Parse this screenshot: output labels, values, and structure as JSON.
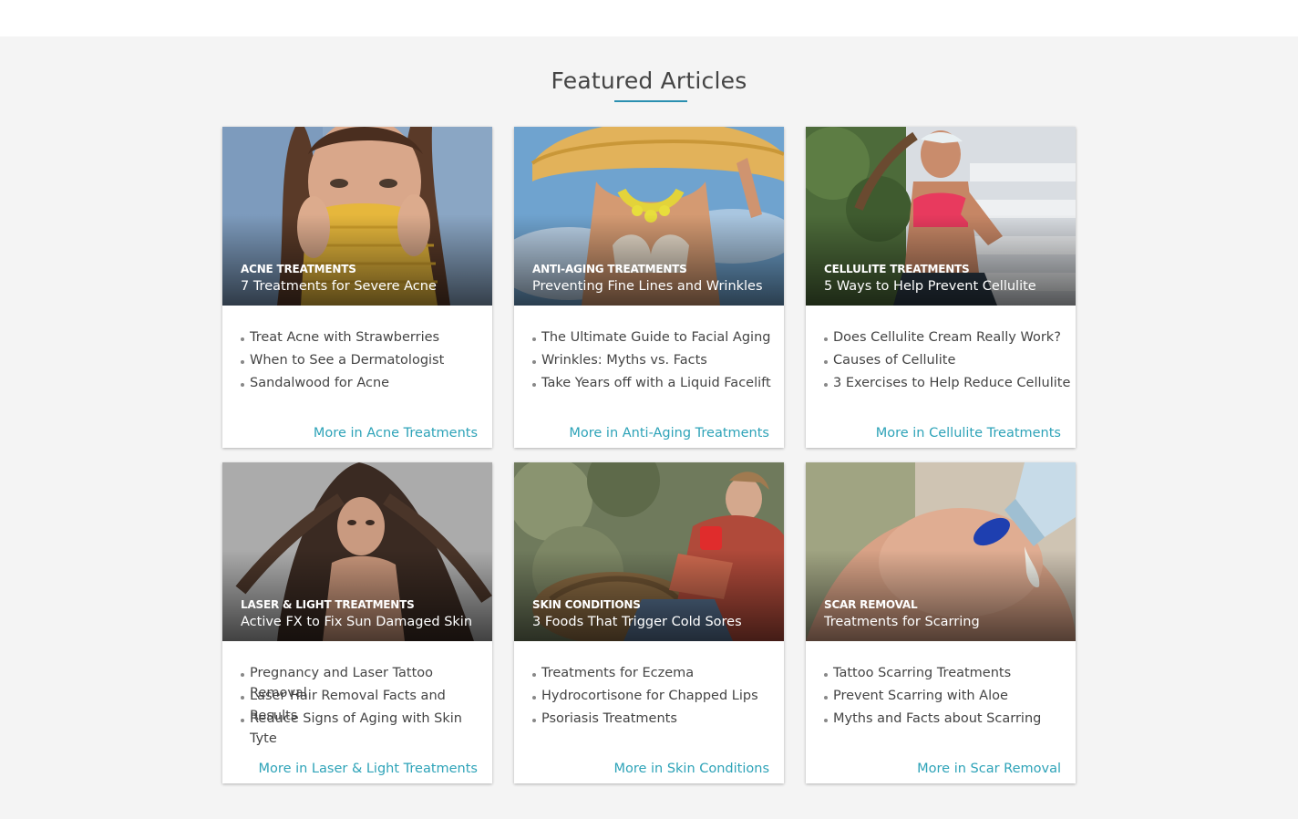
{
  "section": {
    "title": "Featured Articles",
    "accent": "#2a8fb0",
    "link_color": "#2ea3b8"
  },
  "cards": [
    {
      "category": "ACNE TREATMENTS",
      "title": "7 Treatments for Severe Acne",
      "image": "woman-yellow-knit-scarf",
      "links": [
        "Treat Acne with Strawberries",
        "When to See a Dermatologist",
        "Sandalwood for Acne"
      ],
      "more": "More in Acne Treatments"
    },
    {
      "category": "ANTI-AGING TREATMENTS",
      "title": "Preventing Fine Lines and Wrinkles",
      "image": "woman-sun-hat-bikini",
      "links": [
        "The Ultimate Guide to Facial Aging",
        "Wrinkles: Myths vs. Facts",
        "Take Years off with a Liquid Facelift"
      ],
      "more": "More in Anti-Aging Treatments"
    },
    {
      "category": "CELLULITE TREATMENTS",
      "title": "5 Ways to Help Prevent Cellulite",
      "image": "woman-pink-sports-top-stairs",
      "links": [
        "Does Cellulite Cream Really Work?",
        "Causes of Cellulite",
        "3 Exercises to Help Reduce Cellulite"
      ],
      "more": "More in Cellulite Treatments"
    },
    {
      "category": "LASER & LIGHT TREATMENTS",
      "title": "Active FX to Fix Sun Damaged Skin",
      "image": "woman-long-hair",
      "links": [
        "Pregnancy and Laser Tattoo Removal",
        "Laser Hair Removal Facts and Results",
        "Reduce Signs of Aging with Skin Tyte"
      ],
      "more": "More in Laser & Light Treatments"
    },
    {
      "category": "SKIN CONDITIONS",
      "title": "3 Foods That Trigger Cold Sores",
      "image": "woman-red-mug-blanket",
      "links": [
        "Treatments for Eczema",
        "Hydrocortisone for Chapped Lips",
        "Psoriasis Treatments"
      ],
      "more": "More in Skin Conditions"
    },
    {
      "category": "SCAR REMOVAL",
      "title": "Treatments for Scarring",
      "image": "cream-tube-on-skin",
      "links": [
        "Tattoo Scarring Treatments",
        "Prevent Scarring with Aloe",
        "Myths and Facts about Scarring"
      ],
      "more": "More in Scar Removal"
    }
  ]
}
